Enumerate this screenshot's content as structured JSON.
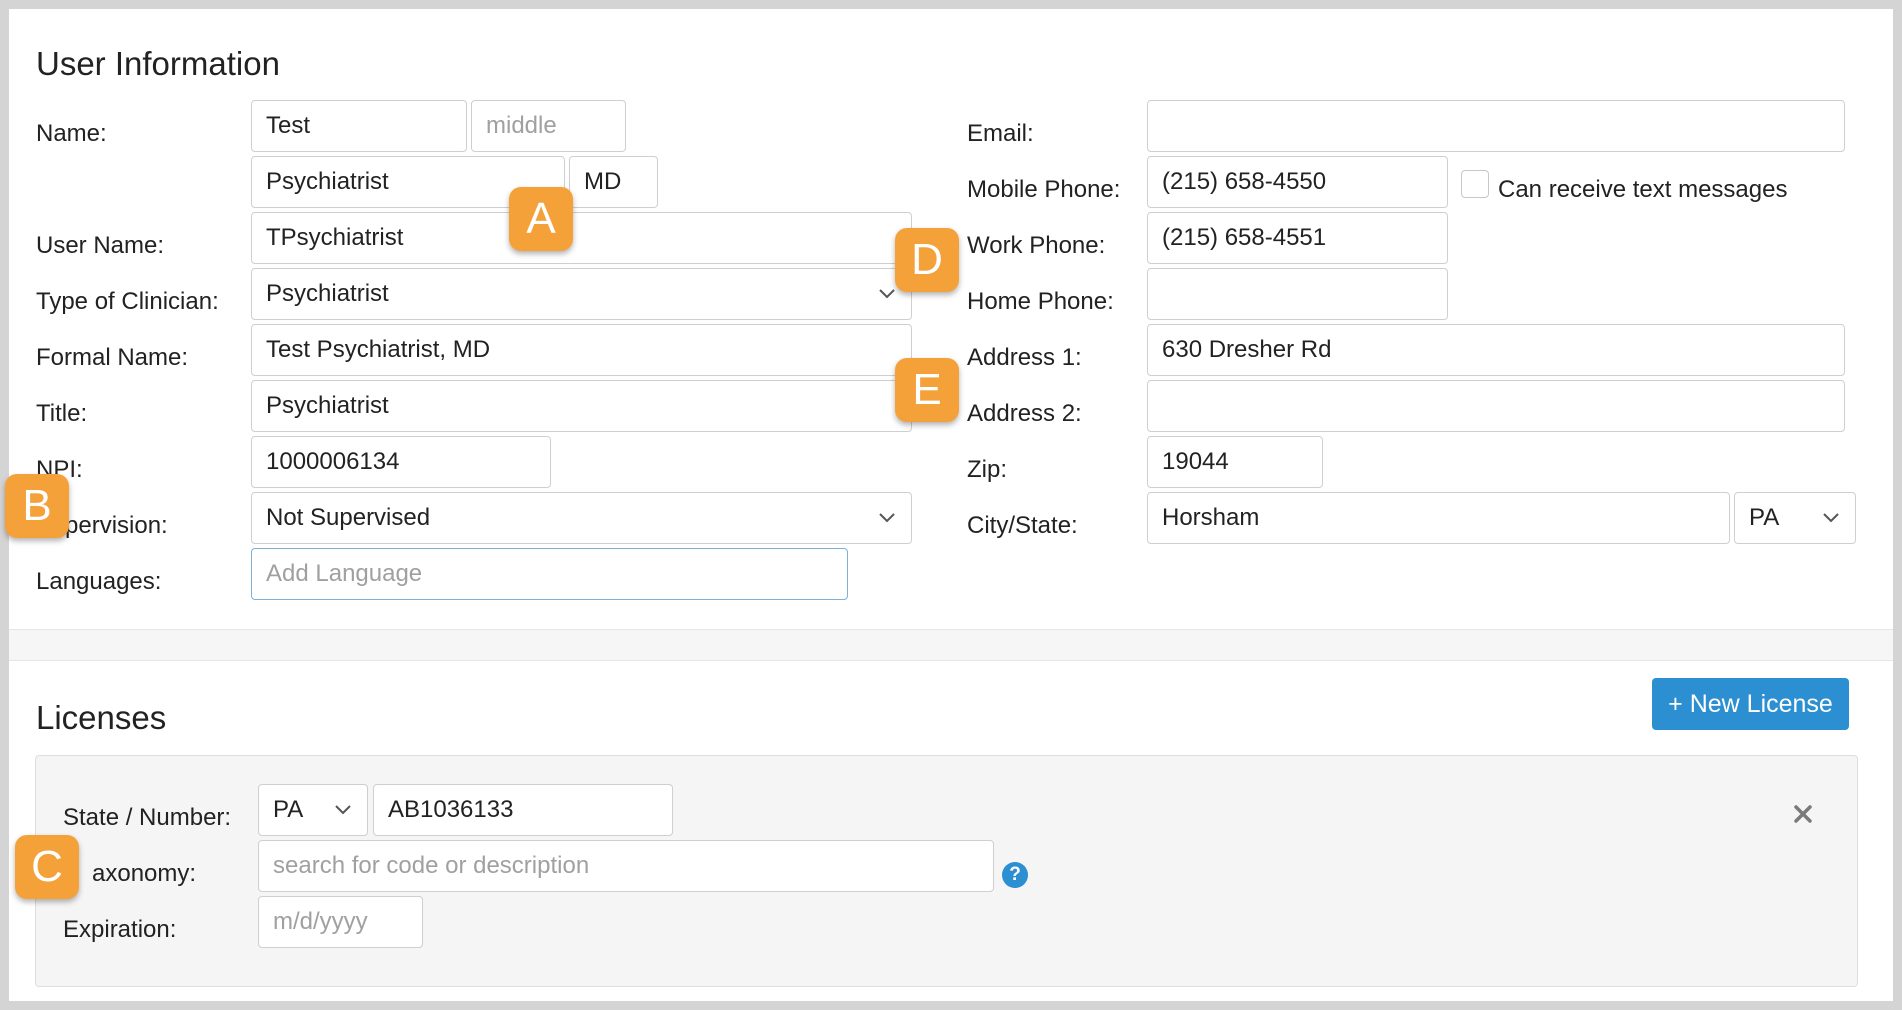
{
  "user_info": {
    "title": "User Information",
    "labels": {
      "name": "Name:",
      "user_name": "User Name:",
      "clinician_type": "Type of Clinician:",
      "formal_name": "Formal Name:",
      "title": "Title:",
      "npi": "NPI:",
      "supervision": "pervision:",
      "languages": "Languages:",
      "email": "Email:",
      "mobile_phone": "Mobile Phone:",
      "work_phone": "Work Phone:",
      "home_phone": "Home Phone:",
      "address1": "Address 1:",
      "address2": "Address 2:",
      "zip": "Zip:",
      "city_state": "City/State:"
    },
    "fields": {
      "first_name": "Test",
      "middle_placeholder": "middle",
      "last_name": "Psychiatrist",
      "suffix": "MD",
      "user_name": "TPsychiatrist",
      "clinician_type": "Psychiatrist",
      "formal_name": "Test Psychiatrist, MD",
      "title": "Psychiatrist",
      "npi": "1000006134",
      "supervision": "Not Supervised",
      "language_placeholder": "Add Language",
      "email": "",
      "mobile_phone": "(215) 658-4550",
      "work_phone": "(215) 658-4551",
      "home_phone": "",
      "address1": "630 Dresher Rd",
      "address2": "",
      "zip": "19044",
      "city": "Horsham",
      "state": "PA"
    },
    "can_receive_text": "Can receive text messages"
  },
  "licenses": {
    "title": "Licenses",
    "new_button": "+ New License",
    "labels": {
      "state_number": "State / Number:",
      "taxonomy": "axonomy:",
      "expiration": "Expiration:"
    },
    "fields": {
      "state": "PA",
      "number": "AB1036133",
      "taxonomy_placeholder": "search for code or description",
      "expiration_placeholder": "m/d/yyyy"
    },
    "help_glyph": "?"
  },
  "badges": [
    "A",
    "B",
    "C",
    "D",
    "E"
  ],
  "colors": {
    "accent": "#2b8fd1",
    "badge": "#f5a13a"
  },
  "icons": {
    "dropdown": "chevron-down-icon",
    "remove": "close-icon",
    "help": "help-icon"
  }
}
